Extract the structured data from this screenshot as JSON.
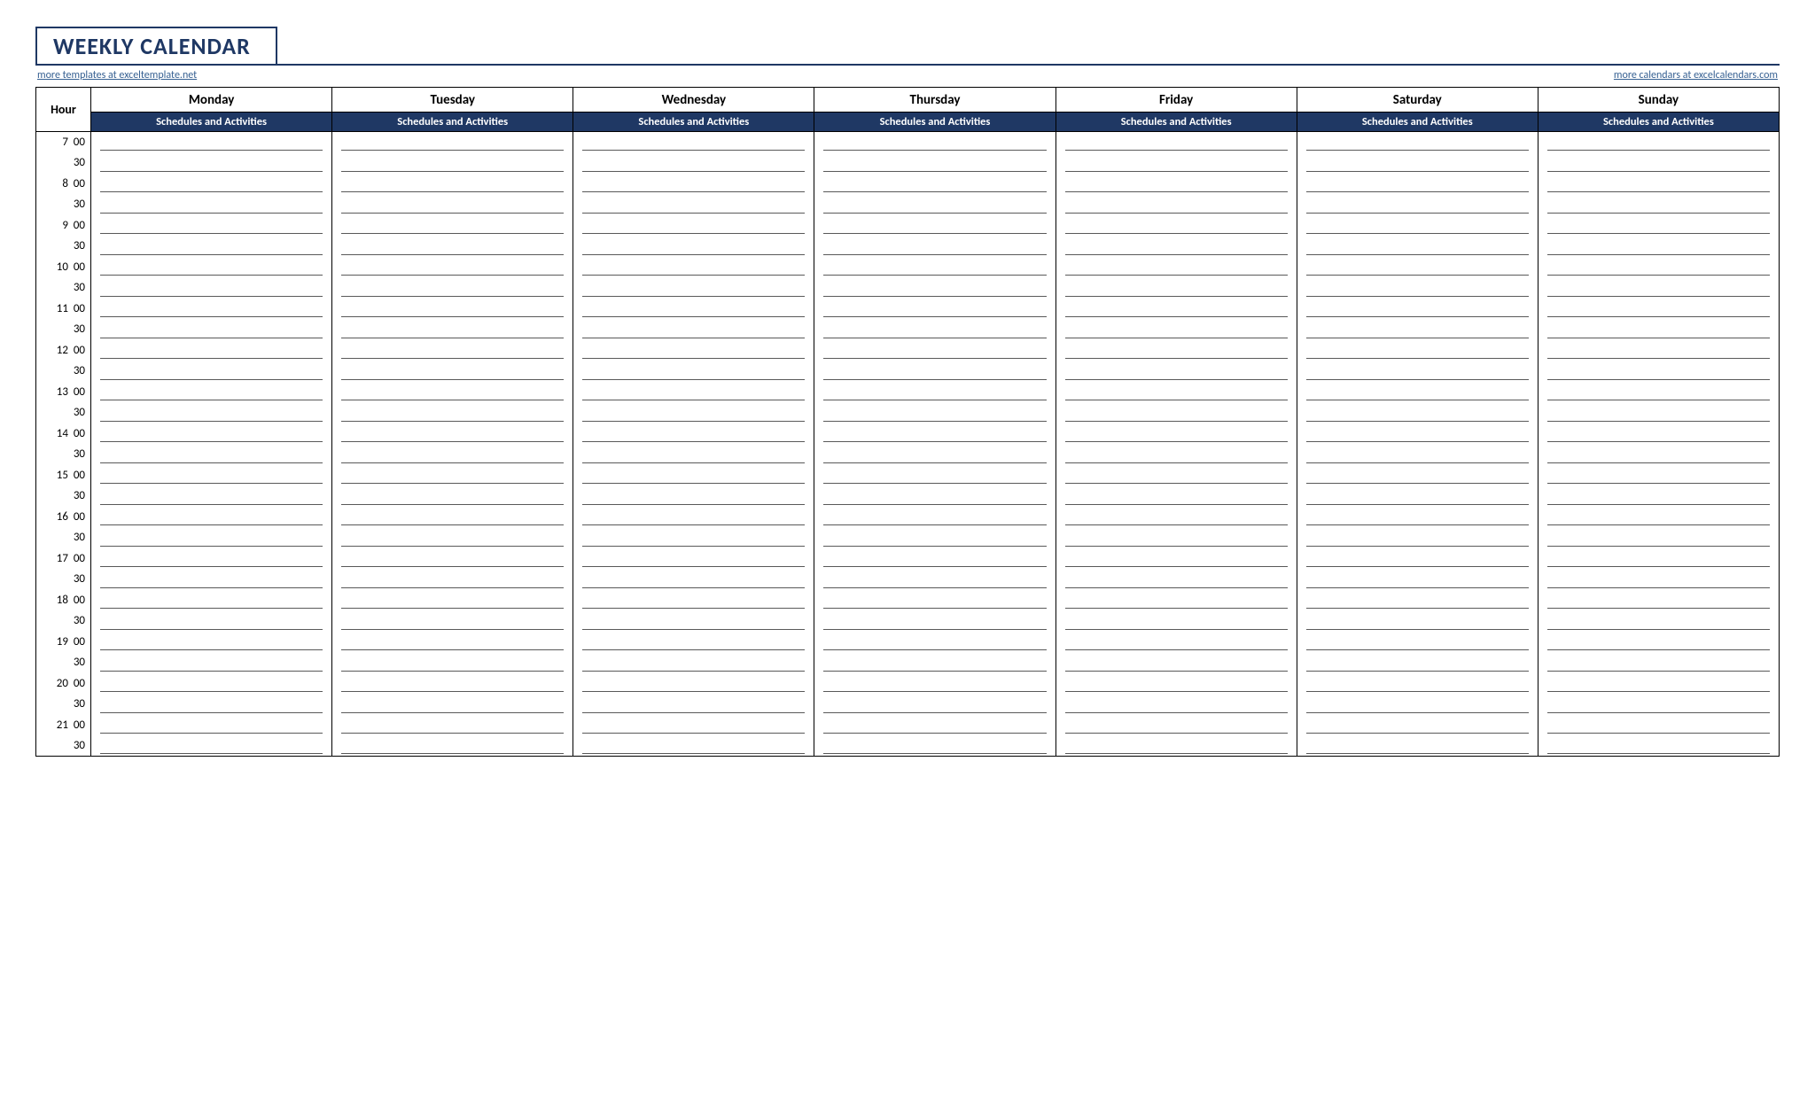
{
  "title": "WEEKLY CALENDAR",
  "links": {
    "left": "more templates at exceltemplate.net",
    "right": "more calendars at excelcalendars.com"
  },
  "hour_label": "Hour",
  "subheader": "Schedules and Activities",
  "days": [
    "Monday",
    "Tuesday",
    "Wednesday",
    "Thursday",
    "Friday",
    "Saturday",
    "Sunday"
  ],
  "hours": [
    7,
    8,
    9,
    10,
    11,
    12,
    13,
    14,
    15,
    16,
    17,
    18,
    19,
    20,
    21
  ],
  "minute_marks": [
    "00",
    "30"
  ]
}
